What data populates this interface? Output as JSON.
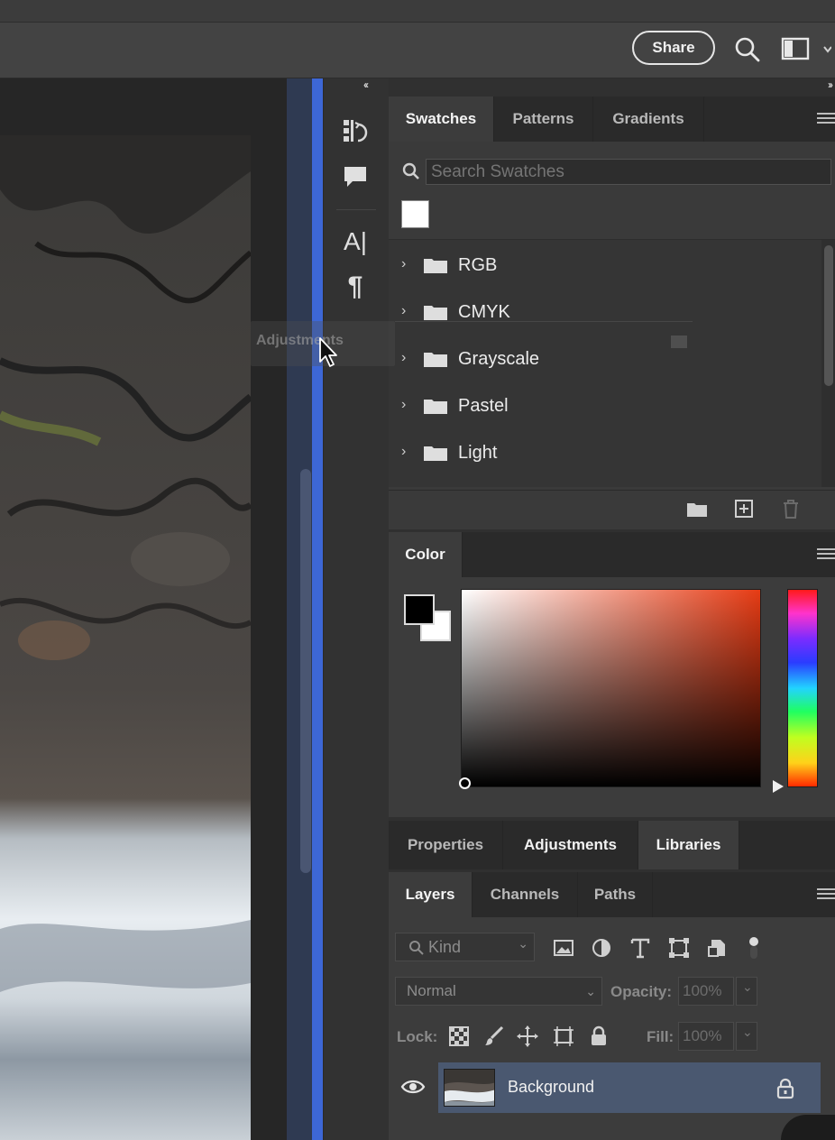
{
  "topbar": {
    "share_label": "Share",
    "search_icon": "search-icon",
    "workspace_icon": "workspace-layout-icon"
  },
  "dock": {
    "collapse_left": "‹‹",
    "collapse_right": "››",
    "icons": [
      "history-icon",
      "comments-icon",
      "character-icon",
      "paragraph-icon"
    ],
    "character_glyph": "A|",
    "paragraph_glyph": "¶"
  },
  "drag": {
    "ghost_label": "Adjustments"
  },
  "swatches": {
    "tabs": [
      "Swatches",
      "Patterns",
      "Gradients"
    ],
    "active_tab": "Swatches",
    "search_placeholder": "Search Swatches",
    "recent_color": "#ffffff",
    "groups": [
      "RGB",
      "CMYK",
      "Grayscale",
      "Pastel",
      "Light"
    ]
  },
  "color": {
    "tab": "Color",
    "foreground": "#000000",
    "background": "#ffffff",
    "hue_color": "#e63b14"
  },
  "properties_group": {
    "tabs": [
      "Properties",
      "Adjustments",
      "Libraries"
    ],
    "active_tab": "Libraries"
  },
  "layers": {
    "tabs": [
      "Layers",
      "Channels",
      "Paths"
    ],
    "active_tab": "Layers",
    "kind_filter": "Kind",
    "blend_mode": "Normal",
    "opacity_label": "Opacity:",
    "opacity_value": "100%",
    "lock_label": "Lock:",
    "fill_label": "Fill:",
    "fill_value": "100%",
    "rows": [
      {
        "name": "Background",
        "visible": true,
        "locked": true
      }
    ]
  }
}
